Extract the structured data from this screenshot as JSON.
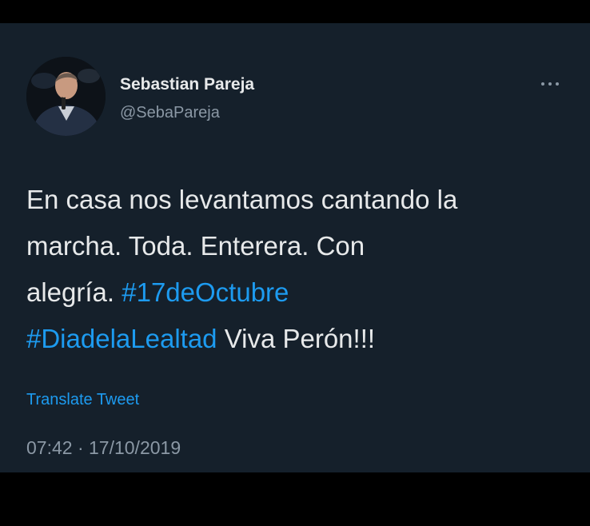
{
  "tweet": {
    "author": {
      "display_name": "Sebastian Pareja",
      "handle": "@SebaPareja"
    },
    "more_icon": "more-horizontal-icon",
    "text_lines": [
      {
        "text": "En casa nos levantamos cantando la"
      },
      {
        "text": "marcha. Toda. Enterera. Con"
      },
      {
        "pre": "alegría. ",
        "hashtag": "#17deOctubre"
      },
      {
        "hashtag": "#DiadelaLealtad",
        "post": " Viva Perón!!!"
      }
    ],
    "translate_label": "Translate Tweet",
    "timestamp": "07:42 · 17/10/2019"
  },
  "colors": {
    "background": "#15202b",
    "text": "#e7e9ea",
    "secondary": "#8b98a5",
    "accent": "#1d9bf0"
  }
}
